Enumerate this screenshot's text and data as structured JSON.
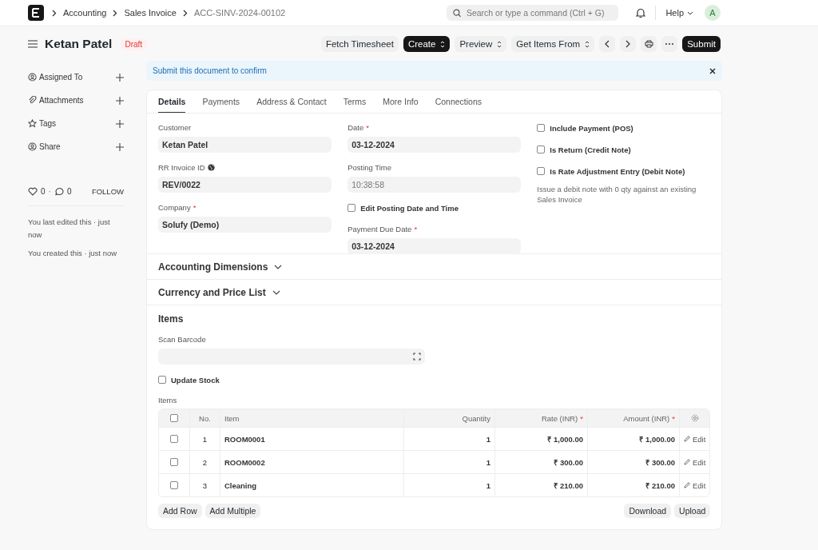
{
  "navbar": {
    "breadcrumbs": [
      "Accounting",
      "Sales Invoice",
      "ACC-SINV-2024-00102"
    ],
    "search": {
      "placeholder": "Search or type a command (Ctrl + G)"
    },
    "help": "Help",
    "avatar": "A"
  },
  "header": {
    "title": "Ketan Patel",
    "status": "Draft",
    "buttons": [
      {
        "label": "Fetch Timesheet",
        "kind": "text",
        "primary": false
      },
      {
        "label": "Create",
        "kind": "menu",
        "primary": true
      },
      {
        "label": "Preview",
        "kind": "menu",
        "primary": false
      },
      {
        "label": "Get Items From",
        "kind": "menu",
        "primary": false
      },
      {
        "kind": "prev",
        "primary": false
      },
      {
        "kind": "next",
        "primary": false
      },
      {
        "kind": "print",
        "primary": false
      },
      {
        "kind": "more",
        "primary": false
      },
      {
        "label": "Submit",
        "kind": "text",
        "primary": true
      }
    ]
  },
  "sidebar": {
    "items": [
      {
        "label": "Assigned To"
      },
      {
        "label": "Attachments"
      },
      {
        "label": "Tags"
      },
      {
        "label": "Share"
      }
    ],
    "likes": "0",
    "separator": "·",
    "comments": "0",
    "follow": "FOLLOW",
    "activity": [
      "You last edited this · just now",
      "You created this · just now"
    ]
  },
  "alert": {
    "text": "Submit this document to confirm"
  },
  "tabs": [
    {
      "label": "Details",
      "selected": true
    },
    {
      "label": "Payments",
      "selected": false
    },
    {
      "label": "Address & Contact",
      "selected": false
    },
    {
      "label": "Terms",
      "selected": false
    },
    {
      "label": "More Info",
      "selected": false
    },
    {
      "label": "Connections",
      "selected": false
    }
  ],
  "columns": [
    [
      {
        "kind": "input",
        "label": "Customer",
        "disabled": false,
        "value": "Ketan Patel"
      },
      {
        "kind": "input",
        "label": "RR Invoice ID",
        "globe": true,
        "disabled": false,
        "value": "REV/0022"
      },
      {
        "kind": "input",
        "label": "Company",
        "required_mark": "*",
        "disabled": false,
        "value": "Solufy (Demo)"
      }
    ],
    [
      {
        "kind": "input",
        "label": "Date",
        "required_mark": "*",
        "disabled": false,
        "value": "03-12-2024"
      },
      {
        "kind": "input",
        "label": "Posting Time",
        "disabled": true,
        "value": "10:38:58"
      },
      {
        "kind": "checkbox",
        "label": "Edit Posting Date and Time",
        "checked": false
      },
      {
        "kind": "input",
        "label": "Payment Due Date",
        "required_mark": "*",
        "disabled": false,
        "value": "03-12-2024"
      }
    ],
    [
      {
        "kind": "checkbox",
        "label": "Include Payment (POS)",
        "checked": false
      },
      {
        "kind": "checkbox",
        "label": "Is Return (Credit Note)",
        "checked": false
      },
      {
        "kind": "checkbox",
        "label": "Is Rate Adjustment Entry (Debit Note)",
        "checked": false
      },
      {
        "kind": "note",
        "text": "Issue a debit note with 0 qty against an existing Sales Invoice"
      }
    ]
  ],
  "sections": [
    {
      "title": "Accounting Dimensions",
      "expanded": false
    },
    {
      "title": "Currency and Price List",
      "expanded": false
    }
  ],
  "items": {
    "title": "Items",
    "barcode_label": "Scan Barcode",
    "update_stock": {
      "label": "Update Stock",
      "checked": false
    },
    "table_label": "Items",
    "table": {
      "all_checked": false,
      "columns": [
        {
          "label": "No."
        },
        {
          "label": "Item"
        },
        {
          "label": "Quantity"
        },
        {
          "label": "Rate (INR)",
          "required_mark": "*"
        },
        {
          "label": "Amount (INR)",
          "required_mark": "*"
        }
      ],
      "rows": [
        {
          "checked": false,
          "no": "1",
          "item": "ROOM0001",
          "qty": "1",
          "rate": "₹ 1,000.00",
          "amount": "₹ 1,000.00",
          "edit": "Edit"
        },
        {
          "checked": false,
          "no": "2",
          "item": "ROOM0002",
          "qty": "1",
          "rate": "₹ 300.00",
          "amount": "₹ 300.00",
          "edit": "Edit"
        },
        {
          "checked": false,
          "no": "3",
          "item": "Cleaning",
          "qty": "1",
          "rate": "₹ 210.00",
          "amount": "₹ 210.00",
          "edit": "Edit"
        }
      ]
    },
    "left_buttons": [
      "Add Row",
      "Add Multiple"
    ],
    "right_buttons": [
      "Download",
      "Upload"
    ]
  }
}
